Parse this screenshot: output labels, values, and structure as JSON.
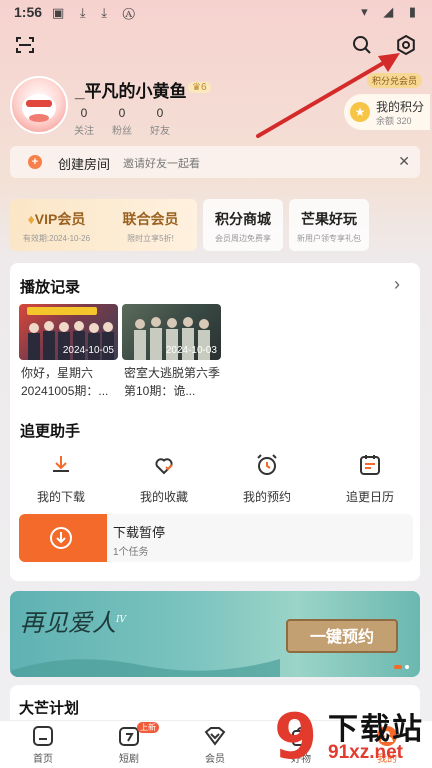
{
  "status_bar": {
    "time": "1:56",
    "icons": [
      "sim-icon",
      "download-icon",
      "download-icon",
      "a-icon"
    ],
    "right_icons": [
      "wifi-icon",
      "signal-icon",
      "battery-icon"
    ]
  },
  "header": {
    "icons": [
      "scan-icon",
      "search-icon",
      "settings-icon"
    ]
  },
  "profile": {
    "username": "_平凡的小黄鱼",
    "level_badge": "6",
    "stats": [
      {
        "value": "0",
        "label": "关注"
      },
      {
        "value": "0",
        "label": "粉丝"
      },
      {
        "value": "0",
        "label": "好友"
      }
    ]
  },
  "points": {
    "tag": "积分兑会员",
    "title": "我的积分",
    "balance": "余额 320"
  },
  "room": {
    "title": "创建房间",
    "subtitle": "邀请好友一起看"
  },
  "member_cards": [
    {
      "title": "VIP会员",
      "subtitle": "有效期:2024-10-26"
    },
    {
      "title": "联合会员",
      "subtitle": "限时立享5折!"
    },
    {
      "title": "积分商城",
      "subtitle": "会员周边免费享"
    },
    {
      "title": "芒果好玩",
      "subtitle": "新用户领专享礼包"
    }
  ],
  "history": {
    "title": "播放记录",
    "items": [
      {
        "date": "2024-10-05",
        "title": "你好，星期六 20241005期：..."
      },
      {
        "date": "2024-10-03",
        "title": "密室大逃脱第六季 第10期：诡..."
      }
    ]
  },
  "assistant": {
    "title": "追更助手",
    "tools": [
      {
        "label": "我的下载",
        "icon": "download-icon"
      },
      {
        "label": "我的收藏",
        "icon": "heart-icon"
      },
      {
        "label": "我的预约",
        "icon": "alarm-icon"
      },
      {
        "label": "追更日历",
        "icon": "calendar-icon"
      }
    ],
    "download": {
      "title": "下载暂停",
      "subtitle": "1个任务"
    }
  },
  "banner": {
    "title": "再见爱人",
    "season": "IV",
    "cta": "一键预约"
  },
  "plan": {
    "title": "大芒计划"
  },
  "nav": {
    "items": [
      {
        "label": "首页",
        "icon": "home-icon"
      },
      {
        "label": "短剧",
        "icon": "short-drama-icon",
        "badge": "上新"
      },
      {
        "label": "会员",
        "icon": "vip-icon"
      },
      {
        "label": "好物",
        "icon": "goods-icon"
      },
      {
        "label": "我的",
        "icon": "me-icon"
      }
    ]
  },
  "watermark": {
    "text": "下载站",
    "domain": "91xz.net"
  },
  "colors": {
    "accent": "#f46a2b",
    "vip_gold": "#9a6221",
    "arrow": "#d42a2a"
  }
}
